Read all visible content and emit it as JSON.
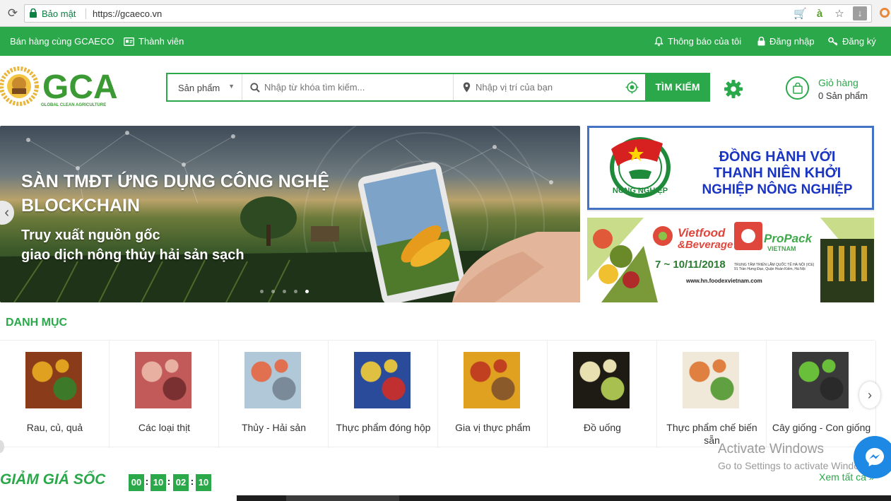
{
  "browser": {
    "secure_label": "Bảo mật",
    "url": "https://gcaeco.vn"
  },
  "topbar": {
    "sell": "Bán hàng cùng GCAECO",
    "member": "Thành viên",
    "notifications": "Thông báo của tôi",
    "login": "Đăng nhập",
    "register": "Đăng ký"
  },
  "logo": {
    "brand": "GCA",
    "tagline": "GLOBAL CLEAN AGRICULTURE"
  },
  "search": {
    "category_selected": "Sản phẩm",
    "keyword_placeholder": "Nhập từ khóa tìm kiếm...",
    "location_placeholder": "Nhập vị trí của bạn",
    "button": "TÌM KIẾM"
  },
  "cart": {
    "title": "Giỏ hàng",
    "count": "0 Sản phẩm"
  },
  "hero": {
    "heading_line1": "SÀN TMĐT ỨNG DỤNG CÔNG NGHỆ",
    "heading_line2": "BLOCKCHAIN",
    "sub_line1": "Truy xuất nguồn gốc",
    "sub_line2": "giao dịch nông thủy hải sản sạch",
    "slide_count": 5,
    "active_slide": 5,
    "prev_arrow": "‹"
  },
  "banner1": {
    "line1": "ĐỒNG HÀNH VỚI",
    "line2": "THANH NIÊN KHỞI",
    "line3": "NGHIỆP NÔNG NGHIỆP",
    "seal_text": "NÔNG NGHIỆP"
  },
  "banner2": {
    "brand1_a": "Vietfood",
    "brand1_b": "&Beverage",
    "brand2_a": "ProPack",
    "brand2_b": "VIETNAM",
    "dates": "7 ~ 10/11/2018",
    "venue": "TRUNG TÂM TRIỂN LÃM QUỐC TẾ HÀ NỘI (ICE)",
    "address": "91 Trần Hưng Đạo, Quận Hoàn Kiếm, Hà Nội",
    "website": "www.hn.foodexvietnam.com"
  },
  "categories": {
    "title": "DANH MỤC",
    "next_arrow": "›",
    "items": [
      {
        "label": "Rau, củ, quả",
        "colors": [
          "#8a3c1a",
          "#e0a020",
          "#3c7a2a"
        ]
      },
      {
        "label": "Các loại thịt",
        "colors": [
          "#c25a5a",
          "#e8b0a0",
          "#7a3030"
        ]
      },
      {
        "label": "Thủy - Hải sản",
        "colors": [
          "#b0c8d8",
          "#e07050",
          "#7a8a98"
        ]
      },
      {
        "label": "Thực phẩm đóng hộp",
        "colors": [
          "#2a4a9a",
          "#e0c040",
          "#c03030"
        ]
      },
      {
        "label": "Gia vị thực phẩm",
        "colors": [
          "#e0a020",
          "#c04020",
          "#8a5a2a"
        ]
      },
      {
        "label": "Đồ uống",
        "colors": [
          "#1e1a14",
          "#e8e0b0",
          "#a8c050"
        ]
      },
      {
        "label": "Thực phẩm chế biến sẵn",
        "colors": [
          "#f0e8d8",
          "#e08040",
          "#60a040"
        ]
      },
      {
        "label": "Cây giống - Con giống",
        "colors": [
          "#3a3a3a",
          "#6abf3a",
          "#2a2a2a"
        ]
      }
    ]
  },
  "flash_sale": {
    "title": "GIẢM GIÁ SỐC",
    "hours": "00",
    "minutes": "10",
    "seconds": "02",
    "centis": "10",
    "see_all": "Xem tất cả »"
  },
  "overlay": {
    "activate_title": "Activate Windows",
    "activate_sub": "Go to Settings to activate Windows."
  },
  "colors": {
    "brand_green": "#2aa84a",
    "banner_blue": "#1a35c4"
  }
}
